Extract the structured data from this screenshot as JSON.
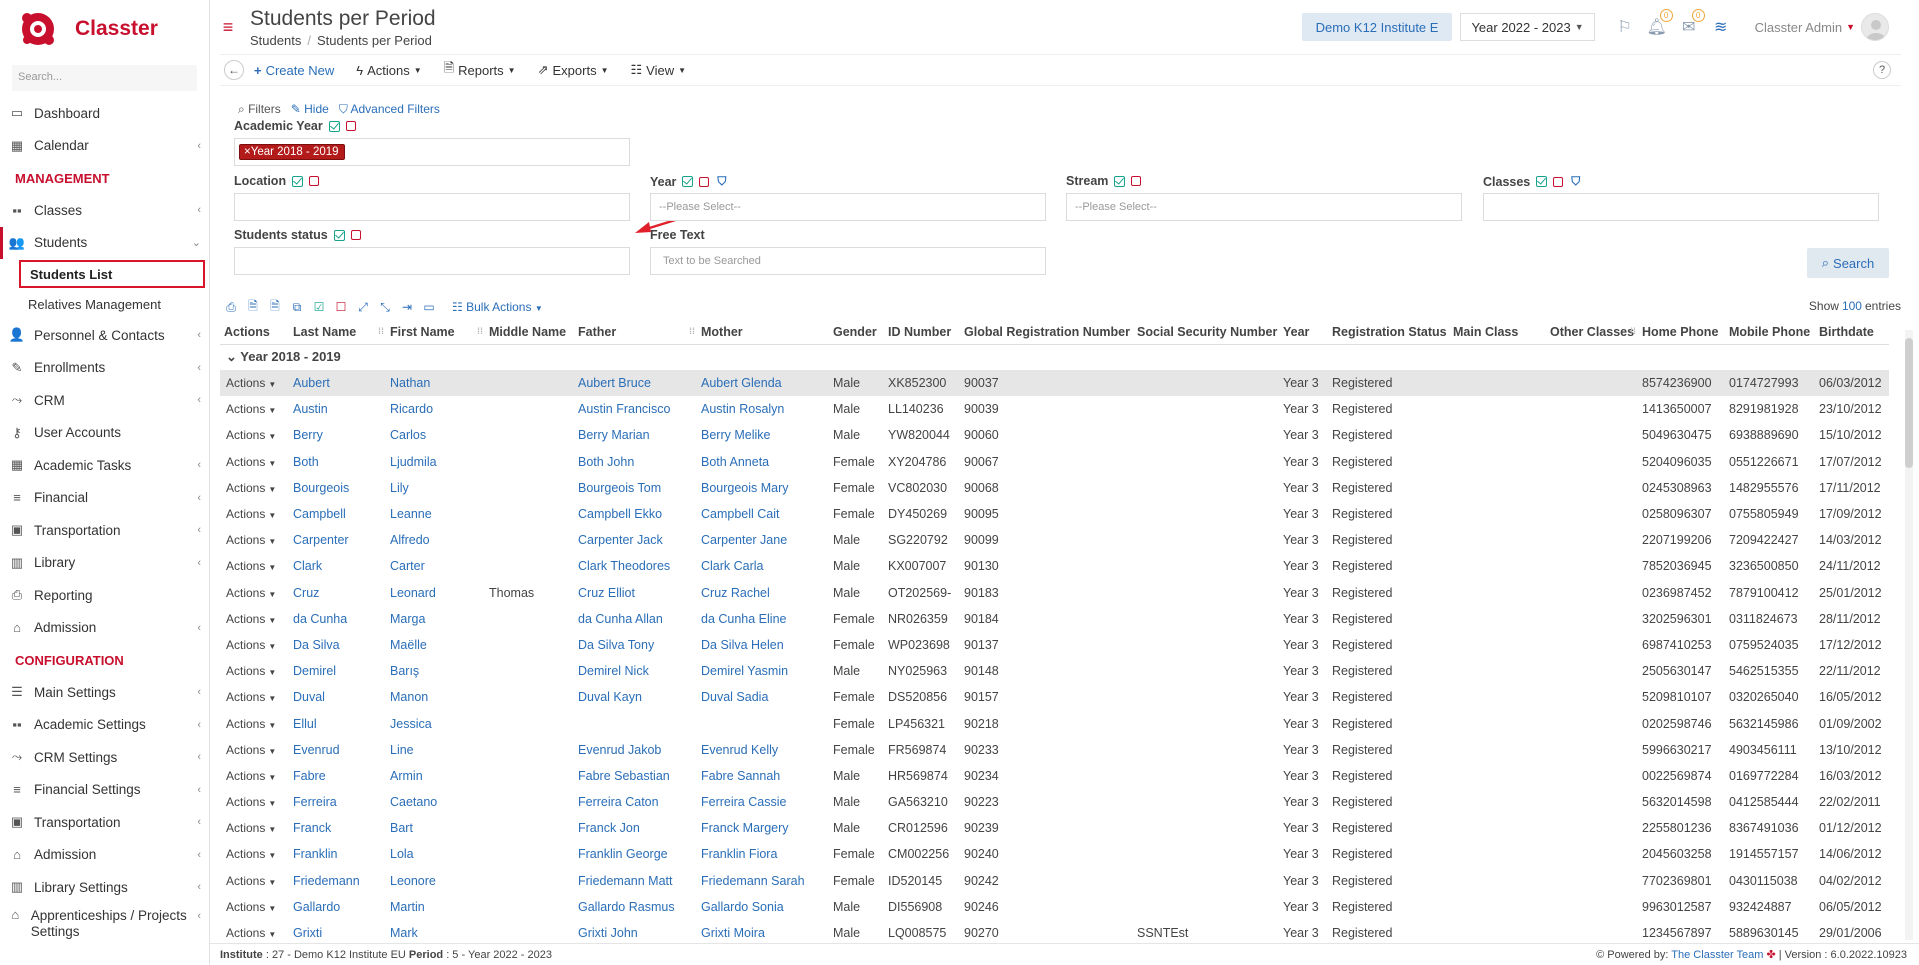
{
  "app": {
    "brand": "Classter",
    "brand_color": "#c8102e"
  },
  "sidebar": {
    "search_placeholder": "Search...",
    "items": [
      {
        "label": "Dashboard",
        "icon": "laptop-icon",
        "chevron": false
      },
      {
        "label": "Calendar",
        "icon": "calendar-icon",
        "chevron": true
      }
    ],
    "section_management": "MANAGEMENT",
    "management": [
      {
        "label": "Classes",
        "icon": "classes-icon",
        "chevron": true
      },
      {
        "label": "Students",
        "icon": "students-icon",
        "chevron": true,
        "open": true
      }
    ],
    "students_sub": [
      {
        "label": "Students List",
        "active": true
      },
      {
        "label": "Relatives Management",
        "active": false
      }
    ],
    "management_rest": [
      {
        "label": "Personnel & Contacts",
        "icon": "personnel-icon"
      },
      {
        "label": "Enrollments",
        "icon": "enrollments-icon"
      },
      {
        "label": "CRM",
        "icon": "crm-icon"
      },
      {
        "label": "User Accounts",
        "icon": "key-icon"
      },
      {
        "label": "Academic Tasks",
        "icon": "tasks-icon"
      },
      {
        "label": "Financial",
        "icon": "coins-icon"
      },
      {
        "label": "Transportation",
        "icon": "bus-icon"
      },
      {
        "label": "Library",
        "icon": "library-icon"
      },
      {
        "label": "Reporting",
        "icon": "printer-icon"
      },
      {
        "label": "Admission",
        "icon": "bank-icon"
      }
    ],
    "section_configuration": "CONFIGURATION",
    "configuration": [
      {
        "label": "Main Settings",
        "icon": "sliders-icon"
      },
      {
        "label": "Academic Settings",
        "icon": "academic-settings-icon"
      },
      {
        "label": "CRM Settings",
        "icon": "crm-icon"
      },
      {
        "label": "Financial Settings",
        "icon": "coins-icon"
      },
      {
        "label": "Transportation",
        "icon": "bus-icon"
      },
      {
        "label": "Admission",
        "icon": "bank-icon"
      },
      {
        "label": "Library Settings",
        "icon": "library-icon"
      },
      {
        "label": "Apprenticeships / Projects Settings",
        "icon": "bank-icon"
      }
    ]
  },
  "header": {
    "title": "Students per Period",
    "breadcrumb": [
      "Students",
      "Students per Period"
    ],
    "institute_button": "Demo K12 Institute E",
    "year_select": "Year 2022 - 2023",
    "notif_count": "0",
    "mail_count": "0",
    "user": "Classter Admin"
  },
  "toolbar": {
    "create": "Create New",
    "actions": "Actions",
    "reports": "Reports",
    "exports": "Exports",
    "view": "View",
    "help": "?"
  },
  "filters": {
    "filters_label": "Filters",
    "hide": "Hide",
    "advanced": "Advanced Filters",
    "academic_year_label": "Academic Year",
    "academic_year_tag": "Year 2018 - 2019",
    "location_label": "Location",
    "year_label": "Year",
    "year_placeholder": "--Please Select--",
    "stream_label": "Stream",
    "stream_placeholder": "--Please Select--",
    "classes_label": "Classes",
    "status_label": "Students status",
    "free_text_label": "Free Text",
    "free_text_placeholder": "Text to be Searched",
    "search_button": "Search"
  },
  "table": {
    "bulk_actions": "Bulk Actions",
    "show_label": "Show",
    "show_count": "100",
    "entries_label": "entries",
    "columns": [
      "Actions",
      "Last Name",
      "First Name",
      "Middle Name",
      "Father",
      "Mother",
      "Gender",
      "ID Number",
      "Global Registration Number",
      "Social Security Number",
      "Year",
      "Registration Status",
      "Main Class",
      "Other Classes",
      "Home Phone",
      "Mobile Phone",
      "Birthdate"
    ],
    "group_label": "Year 2018 - 2019",
    "action_label": "Actions",
    "rows": [
      [
        "Aubert",
        "Nathan",
        "",
        "Aubert Bruce",
        "Aubert Glenda",
        "Male",
        "XK852300",
        "90037",
        "",
        "Year 3",
        "Registered",
        "",
        "",
        "8574236900",
        "0174727993",
        "06/03/2012"
      ],
      [
        "Austin",
        "Ricardo",
        "",
        "Austin Francisco",
        "Austin Rosalyn",
        "Male",
        "LL140236",
        "90039",
        "",
        "Year 3",
        "Registered",
        "",
        "",
        "1413650007",
        "8291981928",
        "23/10/2012"
      ],
      [
        "Berry",
        "Carlos",
        "",
        "Berry Marian",
        "Berry Melike",
        "Male",
        "YW820044",
        "90060",
        "",
        "Year 3",
        "Registered",
        "",
        "",
        "5049630475",
        "6938889690",
        "15/10/2012"
      ],
      [
        "Both",
        "Ljudmila",
        "",
        "Both John",
        "Both Anneta",
        "Female",
        "XY204786",
        "90067",
        "",
        "Year 3",
        "Registered",
        "",
        "",
        "5204096035",
        "0551226671",
        "17/07/2012"
      ],
      [
        "Bourgeois",
        "Lily",
        "",
        "Bourgeois Tom",
        "Bourgeois Mary",
        "Female",
        "VC802030",
        "90068",
        "",
        "Year 3",
        "Registered",
        "",
        "",
        "0245308963",
        "1482955576",
        "17/11/2012"
      ],
      [
        "Campbell",
        "Leanne",
        "",
        "Campbell Ekko",
        "Campbell Cait",
        "Female",
        "DY450269",
        "90095",
        "",
        "Year 3",
        "Registered",
        "",
        "",
        "0258096307",
        "0755805949",
        "17/09/2012"
      ],
      [
        "Carpenter",
        "Alfredo",
        "",
        "Carpenter Jack",
        "Carpenter Jane",
        "Male",
        "SG220792",
        "90099",
        "",
        "Year 3",
        "Registered",
        "",
        "",
        "2207199206",
        "7209422427",
        "14/03/2012"
      ],
      [
        "Clark",
        "Carter",
        "",
        "Clark Theodores",
        "Clark Carla",
        "Male",
        "KX007007",
        "90130",
        "",
        "Year 3",
        "Registered",
        "",
        "",
        "7852036945",
        "3236500850",
        "24/11/2012"
      ],
      [
        "Cruz",
        "Leonard",
        "Thomas",
        "Cruz Elliot",
        "Cruz Rachel",
        "Male",
        "OT202569-",
        "90183",
        "",
        "Year 3",
        "Registered",
        "",
        "",
        "0236987452",
        "7879100412",
        "25/01/2012"
      ],
      [
        "da Cunha",
        "Marga",
        "",
        "da Cunha Allan",
        "da Cunha Eline",
        "Female",
        "NR026359",
        "90184",
        "",
        "Year 3",
        "Registered",
        "",
        "",
        "3202596301",
        "0311824673",
        "28/11/2012"
      ],
      [
        "Da Silva",
        "Maëlle",
        "",
        "Da Silva Tony",
        "Da Silva Helen",
        "Female",
        "WP023698",
        "90137",
        "",
        "Year 3",
        "Registered",
        "",
        "",
        "6987410253",
        "0759524035",
        "17/12/2012"
      ],
      [
        "Demirel",
        "Barış",
        "",
        "Demirel Nick",
        "Demirel Yasmin",
        "Male",
        "NY025963",
        "90148",
        "",
        "Year 3",
        "Registered",
        "",
        "",
        "2505630147",
        "5462515355",
        "22/11/2012"
      ],
      [
        "Duval",
        "Manon",
        "",
        "Duval Kayn",
        "Duval Sadia",
        "Female",
        "DS520856",
        "90157",
        "",
        "Year 3",
        "Registered",
        "",
        "",
        "5209810107",
        "0320265040",
        "16/05/2012"
      ],
      [
        "Ellul",
        "Jessica",
        "",
        "",
        "",
        "Female",
        "LP456321",
        "90218",
        "",
        "Year 3",
        "Registered",
        "",
        "",
        "0202598746",
        "5632145986",
        "01/09/2002"
      ],
      [
        "Evenrud",
        "Line",
        "",
        "Evenrud Jakob",
        "Evenrud Kelly",
        "Female",
        "FR569874",
        "90233",
        "",
        "Year 3",
        "Registered",
        "",
        "",
        "5996630217",
        "4903456111",
        "13/10/2012"
      ],
      [
        "Fabre",
        "Armin",
        "",
        "Fabre Sebastian",
        "Fabre Sannah",
        "Male",
        "HR569874",
        "90234",
        "",
        "Year 3",
        "Registered",
        "",
        "",
        "0022569874",
        "0169772284",
        "16/03/2012"
      ],
      [
        "Ferreira",
        "Caetano",
        "",
        "Ferreira Caton",
        "Ferreira Cassie",
        "Male",
        "GA563210",
        "90223",
        "",
        "Year 3",
        "Registered",
        "",
        "",
        "5632014598",
        "0412585444",
        "22/02/2011"
      ],
      [
        "Franck",
        "Bart",
        "",
        "Franck Jon",
        "Franck Margery",
        "Male",
        "CR012596",
        "90239",
        "",
        "Year 3",
        "Registered",
        "",
        "",
        "2255801236",
        "8367491036",
        "01/12/2012"
      ],
      [
        "Franklin",
        "Lola",
        "",
        "Franklin George",
        "Franklin Fiora",
        "Female",
        "CM002256",
        "90240",
        "",
        "Year 3",
        "Registered",
        "",
        "",
        "2045603258",
        "1914557157",
        "14/06/2012"
      ],
      [
        "Friedemann",
        "Leonore",
        "",
        "Friedemann Matt",
        "Friedemann Sarah",
        "Female",
        "ID520145",
        "90242",
        "",
        "Year 3",
        "Registered",
        "",
        "",
        "7702369801",
        "0430115038",
        "04/02/2012"
      ],
      [
        "Gallardo",
        "Martin",
        "",
        "Gallardo Rasmus",
        "Gallardo Sonia",
        "Male",
        "DI556908",
        "90246",
        "",
        "Year 3",
        "Registered",
        "",
        "",
        "9963012587",
        "932424887",
        "06/05/2012"
      ],
      [
        "Grixti",
        "Mark",
        "",
        "Grixti John",
        "Grixti Moira",
        "Male",
        "LQ008575",
        "90270",
        "SSNTEst",
        "Year 3",
        "Registered",
        "",
        "",
        "1234567897",
        "5889630145",
        "29/01/2006"
      ]
    ]
  },
  "footer": {
    "institute_label": "Institute",
    "institute_value": " : 27 - Demo K12 Institute EU ",
    "period_label": "Period",
    "period_value": " : 5 - Year 2022 - 2023",
    "powered_by": "Powered by:",
    "team": "The Classter Team",
    "version": "| Version : 6.0.2022.10923"
  }
}
